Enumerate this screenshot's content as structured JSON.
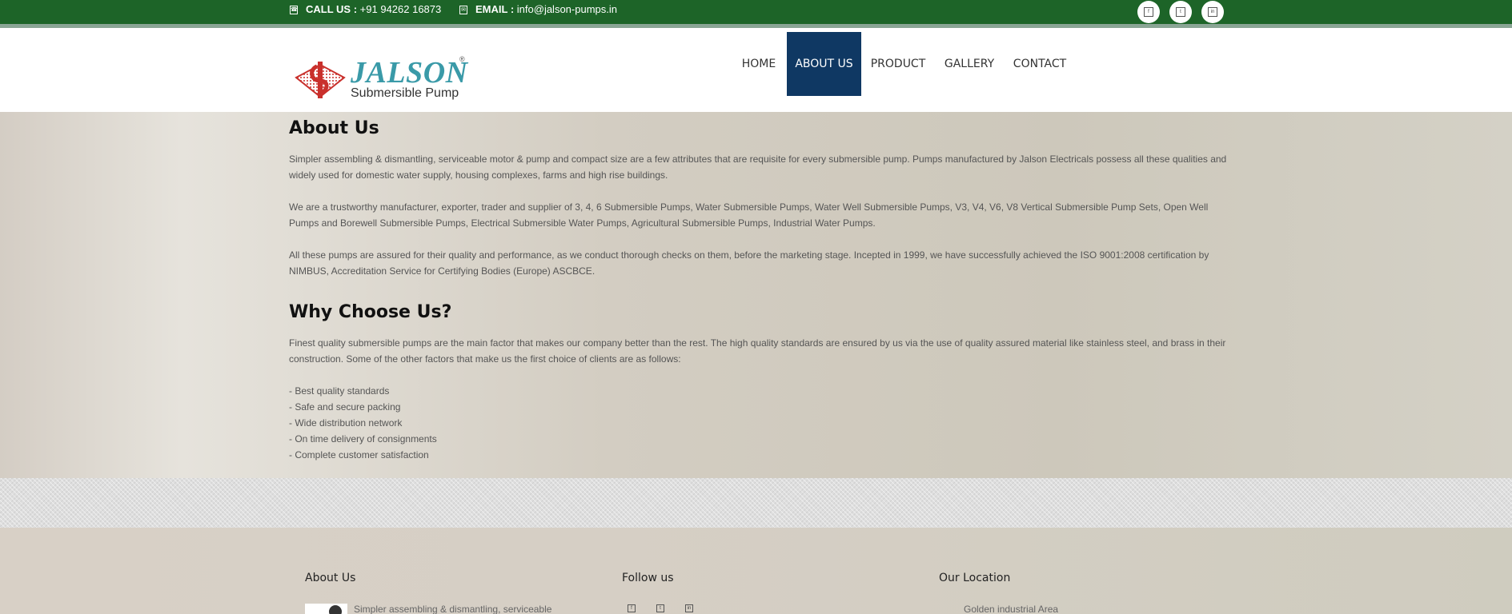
{
  "topbar": {
    "call_label": "CALL US :",
    "call_value": "+91 94262 16873",
    "email_label": "EMAIL :",
    "email_value": "info@jalson-pumps.in",
    "social_icons": [
      "social-icon-1",
      "social-icon-2",
      "social-icon-3"
    ]
  },
  "logo": {
    "name": "JALSON",
    "reg": "®",
    "subtitle": "Submersible Pump"
  },
  "nav": {
    "items": [
      {
        "label": "HOME",
        "active": false
      },
      {
        "label": "ABOUT US",
        "active": true
      },
      {
        "label": "PRODUCT",
        "active": false
      },
      {
        "label": "GALLERY",
        "active": false
      },
      {
        "label": "CONTACT",
        "active": false
      }
    ]
  },
  "about": {
    "title": "About Us",
    "p1": "Simpler assembling & dismantling, serviceable motor & pump and compact size are a few attributes that are requisite for every submersible pump. Pumps manufactured by Jalson Electricals possess all these qualities and widely used for domestic water supply, housing complexes, farms and high rise buildings.",
    "p2": "We are a trustworthy manufacturer, exporter, trader and supplier of 3, 4, 6 Submersible Pumps, Water Submersible Pumps, Water Well Submersible Pumps, V3, V4, V6, V8 Vertical Submersible Pump Sets, Open Well Pumps and Borewell Submersible Pumps, Electrical Submersible Water Pumps, Agricultural Submersible Pumps, Industrial Water Pumps.",
    "p3": "All these pumps are assured for their quality and performance, as we conduct thorough checks on them, before the marketing stage. Incepted in 1999, we have successfully achieved the ISO 9001:2008 certification by NIMBUS, Accreditation Service for Certifying Bodies (Europe) ASCBCE."
  },
  "why": {
    "title": "Why Choose Us?",
    "p1": "Finest quality submersible pumps are the main factor that makes our company better than the rest. The high quality standards are ensured by us via the use of quality assured material like stainless steel, and brass in their construction. Some of the other factors that make us the first choice of clients are as follows:",
    "list": [
      "- Best quality standards",
      "- Safe and secure packing",
      "- Wide distribution network",
      "- On time delivery of consignments",
      "- Complete customer satisfaction"
    ]
  },
  "footer": {
    "about_title": "About Us",
    "about_text": "Simpler assembling & dismantling, serviceable",
    "follow_title": "Follow us",
    "location_title": "Our Location",
    "location_text": "Golden industrial Area"
  }
}
